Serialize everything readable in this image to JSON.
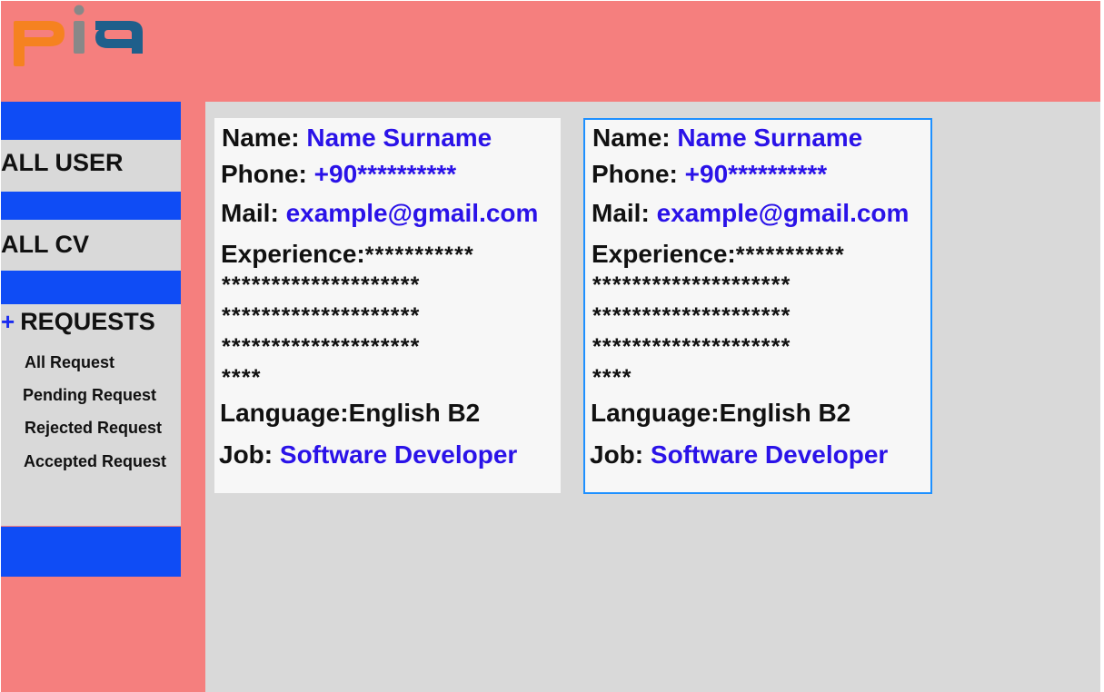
{
  "app": {
    "logo_text": "pia",
    "colors": {
      "header_bg": "#f57f7e",
      "nav_accent": "#0f4cf5",
      "value_text": "#2a12e8",
      "selected_border": "#1e90ff",
      "logo_orange": "#f58220",
      "logo_grey": "#888888",
      "logo_blue": "#1f5f8b"
    }
  },
  "sidebar": {
    "all_user": "ALL USER",
    "all_cv": "ALL CV",
    "requests": {
      "icon": "+",
      "label": "REQUESTS",
      "items": [
        "All Request",
        "Pending Request",
        "Rejected Request",
        "Accepted Request"
      ]
    }
  },
  "cards": [
    {
      "name_label": "Name:",
      "name": "Name Surname",
      "phone_label": "Phone:",
      "phone": "+90**********",
      "mail_label": "Mail:",
      "mail": "example@gmail.com",
      "experience_label": "Experience:",
      "experience_lines": [
        "***********",
        "********************",
        "********************",
        "********************",
        "****"
      ],
      "language_label": "Language:",
      "language": "English B2",
      "job_label": "Job:",
      "job": "Software Developer"
    },
    {
      "name_label": "Name:",
      "name": "Name Surname",
      "phone_label": "Phone:",
      "phone": "+90**********",
      "mail_label": "Mail:",
      "mail": "example@gmail.com",
      "experience_label": "Experience:",
      "experience_lines": [
        "***********",
        "********************",
        "********************",
        "********************",
        "****"
      ],
      "language_label": "Language:",
      "language": "English B2",
      "job_label": "Job:",
      "job": "Software Developer"
    }
  ]
}
